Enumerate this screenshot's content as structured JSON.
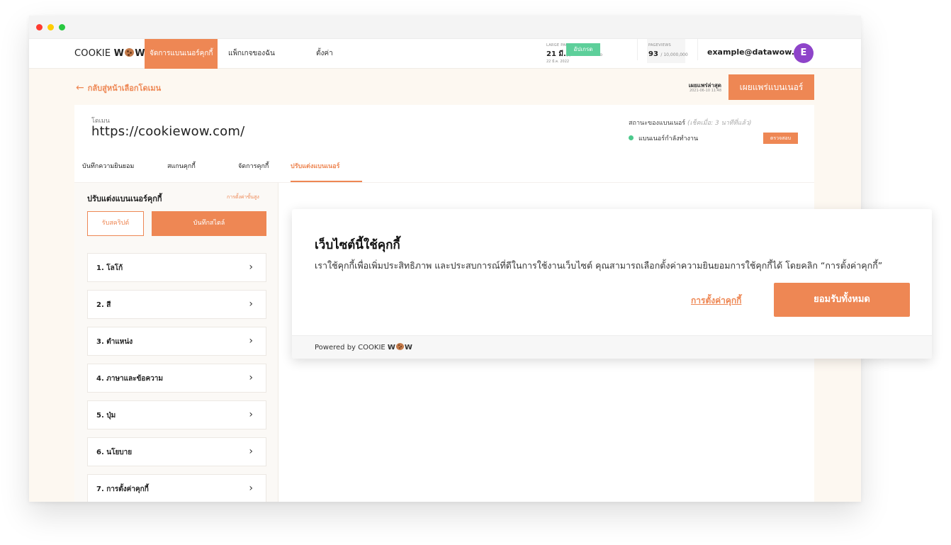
{
  "window": {
    "controls": [
      "close",
      "minimize",
      "maximize"
    ]
  },
  "nav": {
    "logo_prefix": "COOKIE ",
    "logo_w1": "W",
    "logo_w2": "W",
    "items": [
      {
        "label": "จัดการแบนเนอร์คุกกี้",
        "active": true
      },
      {
        "label": "แพ็กเกจของฉัน",
        "active": false
      },
      {
        "label": "ตั้งค่า",
        "active": false
      }
    ],
    "package": {
      "caption": "LARGE PACKAGE",
      "date": "21 มี.ค. 2021",
      "to": "to",
      "end_date": "22 มี.ค. 2022",
      "upgrade_label": "อัปเกรด"
    },
    "pageviews": {
      "caption": "PAGEVIEWS",
      "value": "93",
      "limit": "/ 10,000,000"
    },
    "email": "example@datawow.io",
    "avatar_letter": "E",
    "avatar_color": "#8e44c9"
  },
  "toolbar": {
    "back_label": "กลับสู่หน้าเลือกโดเมน",
    "publish_label": "เผยแพร่ล่าสุด",
    "publish_time": "2021-06-10 11:48",
    "publish_button": "เผยแพร่แบนเนอร์"
  },
  "domain": {
    "label": "โดเมน",
    "url": "https://cookiewow.com/"
  },
  "banner_status": {
    "label": "สถานะของแบนเนอร์",
    "checked_note": "(เช็คเมื่อ: 3 นาทีที่แล้ว)",
    "status": "แบนเนอร์กำลังทำงาน",
    "check_button": "ตรวจสอบ",
    "status_color": "#4cc98c"
  },
  "tabs": [
    {
      "label": "บันทึกความยินยอม",
      "active": false
    },
    {
      "label": "สแกนคุกกี้",
      "active": false
    },
    {
      "label": "จัดการคุกกี้",
      "active": false
    },
    {
      "label": "ปรับแต่งแบนเนอร์",
      "active": true
    }
  ],
  "sidebar": {
    "title": "ปรับแต่งแบนเนอร์คุกกี้",
    "advanced_link": "การตั้งค่าขั้นสูง",
    "subscribe_button": "รับสคริปต์",
    "save_button": "บันทึกสไตล์",
    "items": [
      {
        "label": "1. โลโก้"
      },
      {
        "label": "2. สี"
      },
      {
        "label": "3. ตำแหน่ง"
      },
      {
        "label": "4. ภาษาและข้อความ"
      },
      {
        "label": "5. ปุ่ม"
      },
      {
        "label": "6. นโยบาย"
      },
      {
        "label": "7. การตั้งค่าคุกกี้"
      }
    ]
  },
  "banner_preview": {
    "title": "เว็บไซต์นี้ใช้คุกกี้",
    "description": "เราใช้คุกกี้เพื่อเพิ่มประสิทธิภาพ และประสบการณ์ที่ดีในการใช้งานเว็บไซต์ คุณสามารถเลือกตั้งค่าความยินยอมการใช้คุกกี้ได้ โดยคลิก “การตั้งค่าคุกกี้”",
    "settings_link": "การตั้งค่าคุกกี้",
    "accept_button": "ยอมรับทั้งหมด",
    "powered_by": "Powered by",
    "powered_brand_prefix": "COOKIE ",
    "powered_w1": "W",
    "powered_w2": "W"
  },
  "colors": {
    "accent": "#ee8754",
    "background": "#fdf8f1"
  }
}
